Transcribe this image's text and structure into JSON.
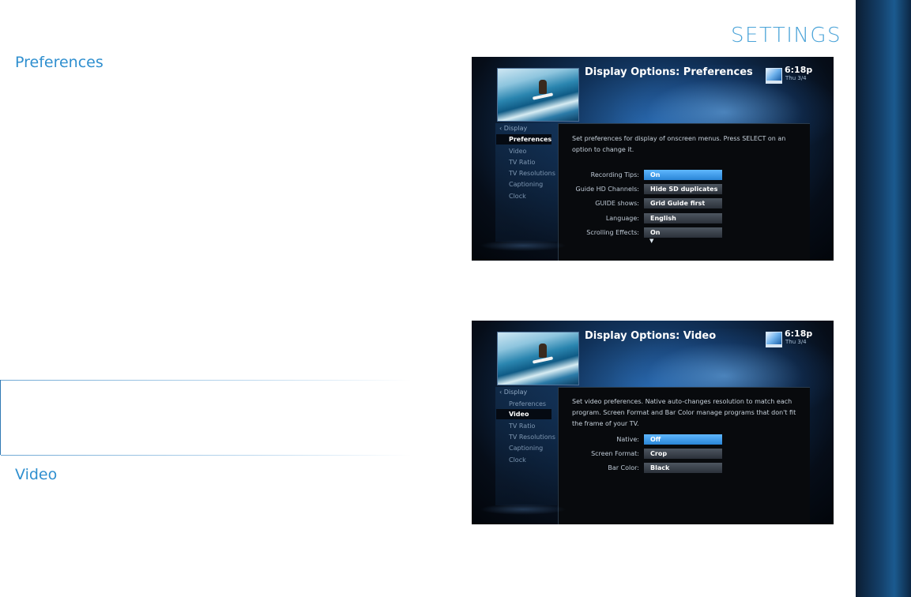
{
  "page_title": "SETTINGS",
  "sections": {
    "preferences_heading": "Preferences",
    "video_heading": "Video"
  },
  "screens": {
    "preferences": {
      "title": "Display Options: Preferences",
      "time": "6:18p",
      "date": "Thu 3/4",
      "menu_back": "Display",
      "menu_items": [
        "Preferences",
        "Video",
        "TV Ratio",
        "TV Resolutions",
        "Captioning",
        "Clock"
      ],
      "active_item": "Preferences",
      "description": "Set preferences for display of onscreen menus. Press SELECT on an option to change it.",
      "options": [
        {
          "label": "Recording Tips:",
          "value": "On"
        },
        {
          "label": "Guide HD Channels:",
          "value": "Hide SD duplicates"
        },
        {
          "label": "GUIDE shows:",
          "value": "Grid Guide first"
        },
        {
          "label": "Language:",
          "value": "English"
        },
        {
          "label": "Scrolling Effects:",
          "value": "On"
        }
      ],
      "more_indicator": "▼"
    },
    "video": {
      "title": "Display Options: Video",
      "time": "6:18p",
      "date": "Thu 3/4",
      "menu_back": "Display",
      "menu_items": [
        "Preferences",
        "Video",
        "TV Ratio",
        "TV Resolutions",
        "Captioning",
        "Clock"
      ],
      "active_item": "Video",
      "description": "Set video preferences. Native auto-changes resolution to match each program. Screen Format and Bar Color manage programs that don't fit the frame of your TV.",
      "options": [
        {
          "label": "Native:",
          "value": "Off"
        },
        {
          "label": "Screen Format:",
          "value": "Crop"
        },
        {
          "label": "Bar Color:",
          "value": "Black"
        }
      ]
    }
  }
}
